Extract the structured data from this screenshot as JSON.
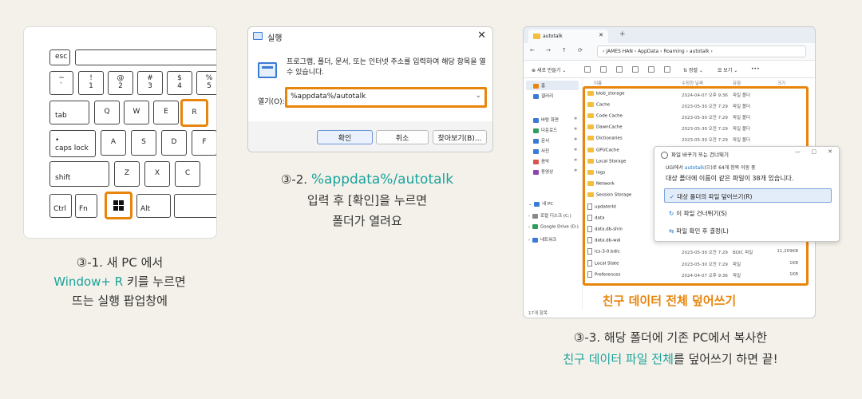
{
  "keyboard": {
    "keys": {
      "esc": "esc",
      "tilde_top": "~",
      "tilde_bottom": "`",
      "one_top": "!",
      "one_bottom": "1",
      "two_top": "@",
      "two_bottom": "2",
      "three_top": "#",
      "three_bottom": "3",
      "four_top": "$",
      "four_bottom": "4",
      "five_top": "%",
      "five_bottom": "5",
      "tab": "tab",
      "q": "Q",
      "w": "W",
      "e": "E",
      "r": "R",
      "caps_dot": "•",
      "caps": "caps lock",
      "a": "A",
      "s": "S",
      "d": "D",
      "f": "F",
      "shift": "shift",
      "z": "Z",
      "x": "X",
      "c": "C",
      "ctrl": "Ctrl",
      "fn": "Fn",
      "alt": "Alt"
    },
    "highlight_color": "#e8850c"
  },
  "caption1": {
    "line1": "③-1. 새 PC 에서",
    "line2_teal": "Window+ R",
    "line2_rest": " 키를 누르면",
    "line3": "뜨는 실행 팝업창에"
  },
  "run_dialog": {
    "title": "실행",
    "close": "✕",
    "description": "프로그램, 폴더, 문서, 또는 인터넷 주소를 입력하여 해당 항목을 열 수 있습니다.",
    "open_label": "열기(O):",
    "open_value": "%appdata%/autotalk",
    "dropdown": "⌄",
    "btn_ok": "확인",
    "btn_cancel": "취소",
    "btn_browse": "찾아보기(B)..."
  },
  "caption2": {
    "line1_prefix": "③-2. ",
    "line1_code": "%appdata%/autotalk",
    "line2": "입력 후 [확인]을 누르면",
    "line3": "폴더가 열려요"
  },
  "explorer": {
    "tab_title": "autotalk",
    "tab_close": "✕",
    "new_tab": "+",
    "nav": [
      "←",
      "→",
      "↑",
      "⟳"
    ],
    "address": "›  JAMES HAN  ›  AppData  ›  Roaming  ›  autotalk  ›",
    "cmd_new": "⊕  새로 만들기 ⌄",
    "cmd_sort": "⇅  정렬 ⌄",
    "cmd_view": "☰  보기 ⌄",
    "cmd_more": "•••",
    "nav_items": [
      {
        "label": "홈",
        "color": "#e8850c"
      },
      {
        "label": "갤러리",
        "color": "#3a7bd5"
      },
      {
        "label": "바탕 화면",
        "color": "#3a7bd5"
      },
      {
        "label": "다운로드",
        "color": "#2e9e5b"
      },
      {
        "label": "문서",
        "color": "#3a7bd5"
      },
      {
        "label": "사진",
        "color": "#3a7bd5"
      },
      {
        "label": "음악",
        "color": "#d9534f"
      },
      {
        "label": "동영상",
        "color": "#8e44ad"
      },
      {
        "label": "내 PC",
        "color": "#3a7bd5"
      },
      {
        "label": "로컬 디스크 (C:)",
        "color": "#888888"
      },
      {
        "label": "Google Drive (D:)",
        "color": "#2e9e5b"
      },
      {
        "label": "네트워크",
        "color": "#3a7bd5"
      }
    ],
    "columns": {
      "name": "이름",
      "date": "수정한 날짜",
      "type": "유형",
      "size": "크기"
    },
    "files": [
      {
        "name": "blob_storage",
        "kind": "folder",
        "date": "2024-04-07 오후 9:36",
        "type": "파일 폴더",
        "size": ""
      },
      {
        "name": "Cache",
        "kind": "folder",
        "date": "2023-05-30 오전 7:29",
        "type": "파일 폴더",
        "size": ""
      },
      {
        "name": "Code Cache",
        "kind": "folder",
        "date": "2023-05-30 오전 7:29",
        "type": "파일 폴더",
        "size": ""
      },
      {
        "name": "DawnCache",
        "kind": "folder",
        "date": "2023-05-30 오전 7:29",
        "type": "파일 폴더",
        "size": ""
      },
      {
        "name": "Dictionaries",
        "kind": "folder",
        "date": "2023-05-30 오전 7:29",
        "type": "파일 폴더",
        "size": ""
      },
      {
        "name": "GPUCache",
        "kind": "folder",
        "date": "",
        "type": "",
        "size": ""
      },
      {
        "name": "Local Storage",
        "kind": "folder",
        "date": "",
        "type": "",
        "size": ""
      },
      {
        "name": "logs",
        "kind": "folder",
        "date": "",
        "type": "",
        "size": ""
      },
      {
        "name": "Network",
        "kind": "folder",
        "date": "",
        "type": "",
        "size": ""
      },
      {
        "name": "Session Storage",
        "kind": "folder",
        "date": "",
        "type": "",
        "size": ""
      },
      {
        "name": "updaterId",
        "kind": "file",
        "date": "",
        "type": "",
        "size": ""
      },
      {
        "name": "data",
        "kind": "file",
        "date": "",
        "type": "",
        "size": ""
      },
      {
        "name": "data.db-shm",
        "kind": "file",
        "date": "",
        "type": "",
        "size": ""
      },
      {
        "name": "data.db-wal",
        "kind": "file",
        "date": "",
        "type": "",
        "size": ""
      },
      {
        "name": "ics-3-0.bdic",
        "kind": "file",
        "date": "2023-05-30 오전 7:29",
        "type": "BDIC 파일",
        "size": "11,209KB"
      },
      {
        "name": "Local State",
        "kind": "file",
        "date": "2023-05-30 오전 7:29",
        "type": "파일",
        "size": "1KB"
      },
      {
        "name": "Preferences",
        "kind": "file",
        "date": "2024-04-07 오후 9:36",
        "type": "파일",
        "size": "1KB"
      }
    ],
    "overlay_label": "친구 데이터 전체 덮어쓰기",
    "status": "17개 항목"
  },
  "replace_dialog": {
    "title": "파일 바꾸기 또는 건너뛰기",
    "min": "—",
    "max": "▢",
    "close": "✕",
    "sub_prefix": "UGI에서 ",
    "sub_link": "autotalk",
    "sub_rest": "(으)로 64개 항목 이동 중",
    "heading": "대상 폴더에 이름이 같은 파일이 38개 있습니다.",
    "opt_replace": "대상 폴더의 파일 덮어쓰기(R)",
    "opt_skip": "이 파일 건너뛰기(S)",
    "opt_decide": "파일 확인 후 결정(L)"
  },
  "caption3": {
    "line1": "③-3. 해당 폴더에 기존 PC에서 복사한",
    "line2_teal": "친구 데이터 파일 전체",
    "line2_rest": "를 덮어쓰기 하면 끝!"
  },
  "colors": {
    "accent": "#e8850c",
    "teal": "#1aa39b"
  }
}
